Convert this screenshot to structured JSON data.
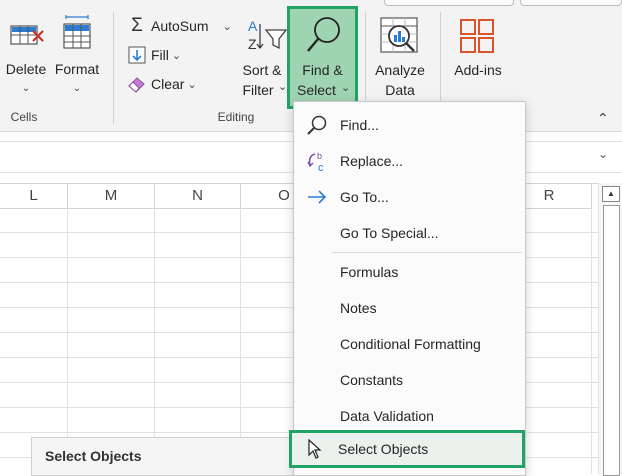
{
  "ribbon": {
    "cells_group": {
      "label": "Cells",
      "delete_label": "Delete",
      "format_label": "Format"
    },
    "editing_group": {
      "label": "Editing",
      "autosum_label": "AutoSum",
      "fill_label": "Fill",
      "clear_label": "Clear",
      "sort_filter_line1": "Sort &",
      "sort_filter_line2": "Filter",
      "find_select_line1": "Find &",
      "find_select_line2": "Select"
    },
    "analyze_line1": "Analyze",
    "analyze_line2": "Data",
    "addins_label": "Add-ins"
  },
  "grid": {
    "columns": [
      "L",
      "M",
      "N",
      "O",
      "R"
    ]
  },
  "menu": {
    "items": [
      {
        "label": "Find...",
        "icon": "magnifier-icon"
      },
      {
        "label": "Replace...",
        "icon": "replace-icon"
      },
      {
        "label": "Go To...",
        "icon": "arrow-right-icon"
      },
      {
        "label": "Go To Special...",
        "icon": ""
      },
      {
        "label": "Formulas",
        "icon": ""
      },
      {
        "label": "Notes",
        "icon": ""
      },
      {
        "label": "Conditional Formatting",
        "icon": ""
      },
      {
        "label": "Constants",
        "icon": ""
      },
      {
        "label": "Data Validation",
        "icon": ""
      },
      {
        "label": "Select Objects",
        "icon": "cursor-arrow-icon"
      }
    ]
  },
  "tooltip": {
    "title": "Select Objects"
  },
  "colors": {
    "highlight_green": "#21a366",
    "find_select_bg": "#9fd4b3",
    "replace_purple": "#7b52ab",
    "goto_blue": "#2b7cd3",
    "delete_red": "#c8302a",
    "addins_orange": "#d9532b"
  }
}
